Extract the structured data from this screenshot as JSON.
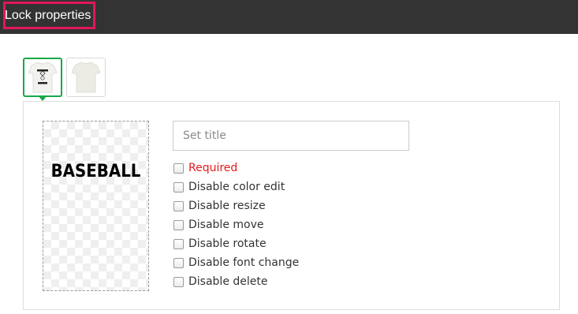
{
  "header": {
    "title": "Lock properties"
  },
  "colors": {
    "header_bg": "#333333",
    "title_highlight": "#e2175a",
    "selected_thumb": "#19a84a",
    "required": "#e21b1b"
  },
  "thumbnails": [
    {
      "name": "tshirt-front-thumbnail",
      "selected": true
    },
    {
      "name": "tshirt-back-thumbnail",
      "selected": false
    }
  ],
  "preview": {
    "text": "BASEBALL"
  },
  "title_field": {
    "placeholder": "Set title",
    "value": ""
  },
  "options": [
    {
      "label": "Required",
      "checked": false
    },
    {
      "label": "Disable color edit",
      "checked": false
    },
    {
      "label": "Disable resize",
      "checked": false
    },
    {
      "label": "Disable move",
      "checked": false
    },
    {
      "label": "Disable rotate",
      "checked": false
    },
    {
      "label": "Disable font change",
      "checked": false
    },
    {
      "label": "Disable delete",
      "checked": false
    }
  ]
}
